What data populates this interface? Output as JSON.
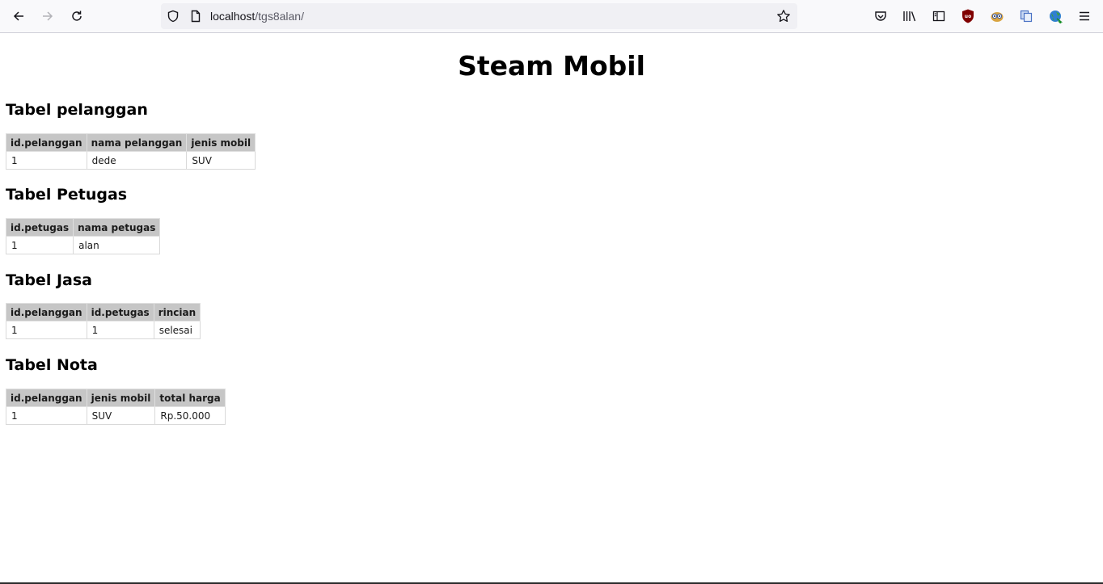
{
  "browser": {
    "url_host": "localhost",
    "url_path": "/tgs8alan/",
    "toolbar_icons": [
      "back-icon",
      "forward-icon",
      "reload-icon",
      "shield-icon",
      "page-icon",
      "star-icon",
      "pocket-icon",
      "library-icon",
      "sidebar-icon",
      "ublock-icon",
      "extension-owl-icon",
      "extension-copy-icon",
      "extension-globe-icon",
      "menu-icon"
    ]
  },
  "page": {
    "title": "Steam Mobil",
    "sections": [
      {
        "title": "Tabel pelanggan",
        "headers": [
          "id.pelanggan",
          "nama pelanggan",
          "jenis mobil"
        ],
        "rows": [
          [
            "1",
            "dede",
            "SUV"
          ]
        ]
      },
      {
        "title": "Tabel Petugas",
        "headers": [
          "id.petugas",
          "nama petugas"
        ],
        "rows": [
          [
            "1",
            "alan"
          ]
        ]
      },
      {
        "title": "Tabel Jasa",
        "headers": [
          "id.pelanggan",
          "id.petugas",
          "rincian"
        ],
        "rows": [
          [
            "1",
            "1",
            "selesai"
          ]
        ]
      },
      {
        "title": "Tabel Nota",
        "headers": [
          "id.pelanggan",
          "jenis mobil",
          "total harga"
        ],
        "rows": [
          [
            "1",
            "SUV",
            "Rp.50.000"
          ]
        ]
      }
    ]
  }
}
